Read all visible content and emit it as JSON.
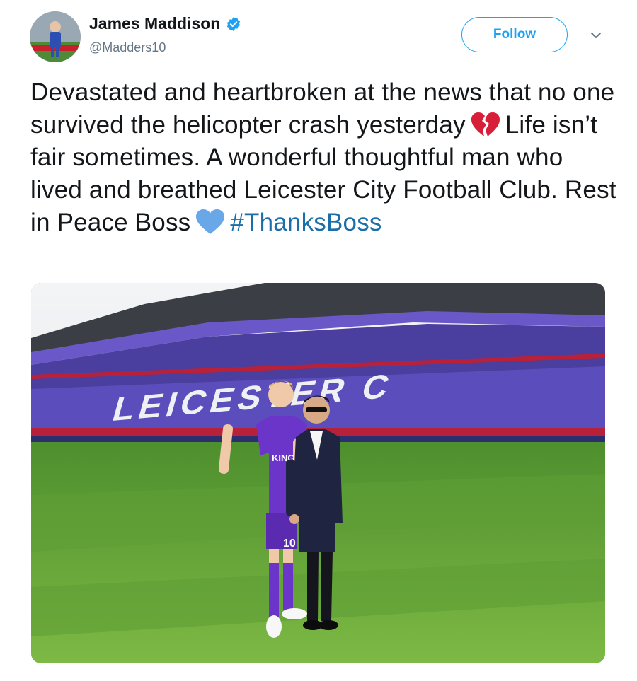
{
  "user": {
    "display_name": "James Maddison",
    "handle": "@Madders10",
    "verified_icon": "verified-badge-icon",
    "avatar": "profile-photo"
  },
  "follow_label": "Follow",
  "tweet": {
    "part1": "Devastated and heartbroken at the news that no one survived the helicopter crash yesterday",
    "emoji1": "broken-heart-emoji",
    "part2": "Life isn’t fair sometimes. A wonderful thoughtful man who lived and breathed Leicester City Football Club. Rest in Peace Boss",
    "emoji2": "blue-heart-emoji",
    "hashtag": "#ThanksBoss"
  },
  "media": {
    "stadium_letters": "LEICESTER C",
    "kit_sponsor": "KING POWER",
    "shirt_number": "10"
  },
  "colors": {
    "twitter_blue": "#1da1f2",
    "hashtag": "#1b6ea8",
    "kit_purple": "#6b35c9",
    "pitch_green": "#6fa83a"
  }
}
